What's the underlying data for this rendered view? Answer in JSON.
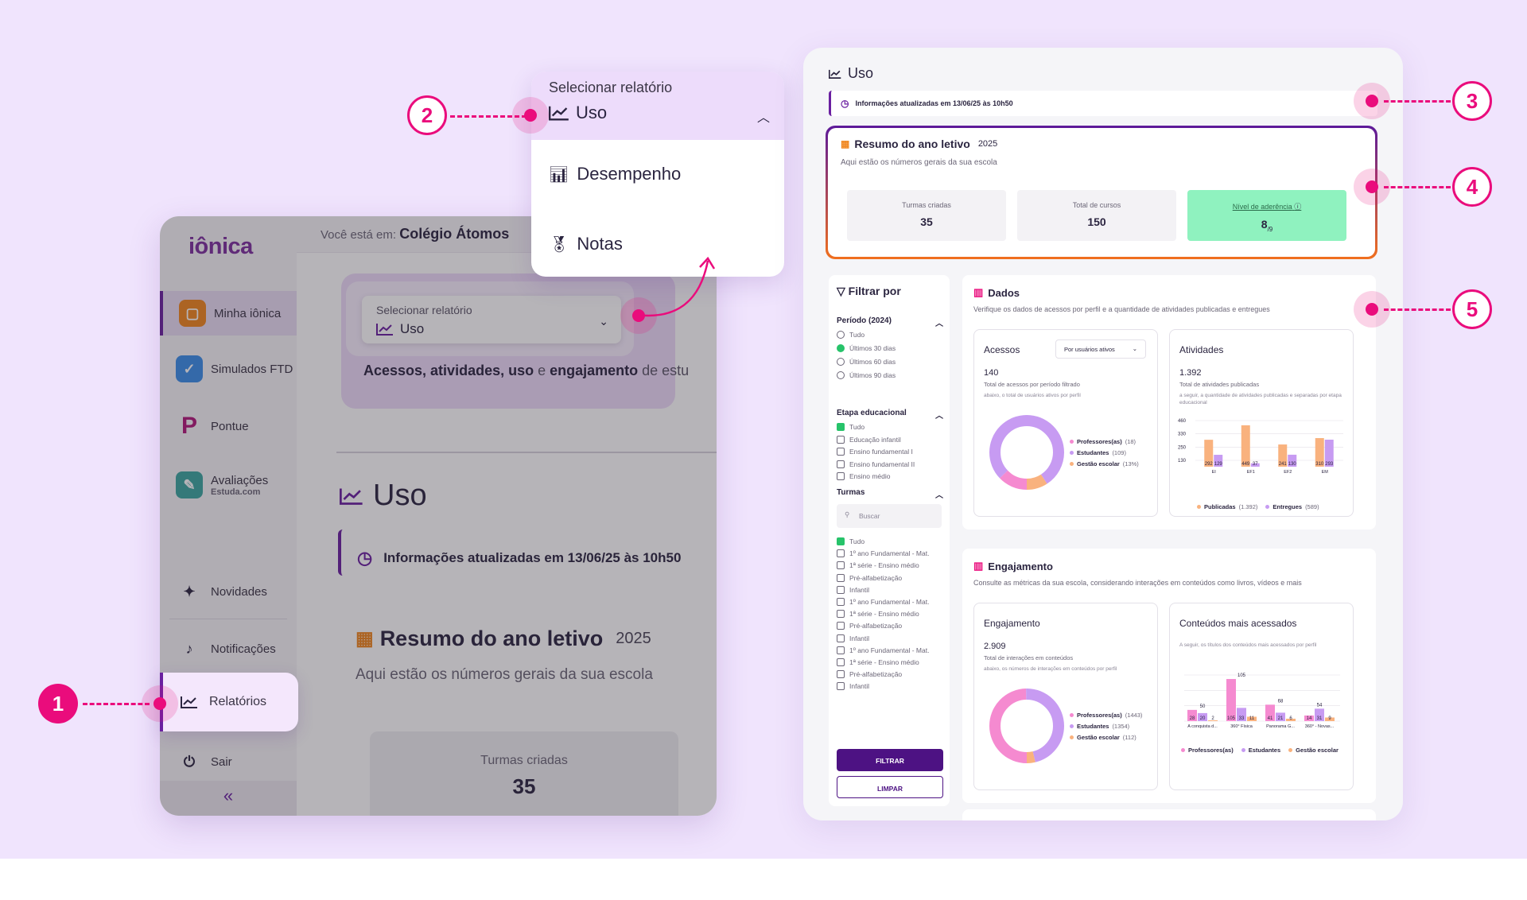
{
  "left_app": {
    "logo_text": "iônica",
    "breadcrumb_prefix": "Você está em:",
    "breadcrumb_school": "Colégio Átomos",
    "sidebar": {
      "items": [
        {
          "label": "Minha iônica",
          "icon": "backpack-icon"
        },
        {
          "label": "Simulados FTD",
          "icon": "checkmark-icon"
        },
        {
          "label": "Pontue",
          "icon": "pontue-logo-icon"
        },
        {
          "label": "Avaliações",
          "sublabel": "Estuda.com",
          "icon": "pencil-icon"
        },
        {
          "label": "Novidades",
          "icon": "sparkle-icon"
        },
        {
          "label": "Notificações",
          "icon": "bell-icon"
        },
        {
          "label": "Relatórios",
          "icon": "chart-line-icon"
        },
        {
          "label": "Sair",
          "icon": "power-icon"
        }
      ],
      "collapse_glyph": "«"
    },
    "report_selector": {
      "label": "Selecionar relatório",
      "value": "Uso"
    },
    "description_parts": [
      "Acessos, atividades, uso",
      " e ",
      "engajamento",
      " de estu"
    ],
    "page_title": "Uso",
    "info_text": "Informações atualizadas em 13/06/25 às 10h50",
    "summary": {
      "title": "Resumo do ano letivo",
      "year": "2025",
      "subtitle": "Aqui estão os números gerais da sua escola",
      "turmas_label": "Turmas criadas",
      "turmas_value": "35"
    }
  },
  "popup": {
    "label": "Selecionar relatório",
    "selected": "Uso",
    "options": [
      "Desempenho",
      "Notas"
    ]
  },
  "dashboard": {
    "title": "Uso",
    "info_text": "Informações atualizadas em 13/06/25 às 10h50",
    "summary": {
      "title": "Resumo do ano letivo",
      "year": "2025",
      "subtitle": "Aqui estão os números gerais da sua escola",
      "stats": [
        {
          "label": "Turmas criadas",
          "value": "35"
        },
        {
          "label": "Total de cursos",
          "value": "150"
        },
        {
          "label": "Nível de aderência",
          "value": "8",
          "suffix": "/9"
        }
      ]
    },
    "filter": {
      "title": "Filtrar por",
      "periodo_title": "Período (2024)",
      "periodo_options": [
        {
          "label": "Tudo",
          "checked": false
        },
        {
          "label": "Últimos 30 dias",
          "checked": true
        },
        {
          "label": "Últimos 60 dias",
          "checked": false
        },
        {
          "label": "Últimos 90 dias",
          "checked": false
        }
      ],
      "etapa_title": "Etapa educacional",
      "etapa_options": [
        {
          "label": "Tudo",
          "checked": true
        },
        {
          "label": "Educação infantil",
          "checked": false
        },
        {
          "label": "Ensino fundamental I",
          "checked": false
        },
        {
          "label": "Ensino fundamental II",
          "checked": false
        },
        {
          "label": "Ensino médio",
          "checked": false
        }
      ],
      "turmas_title": "Turmas",
      "search_placeholder": "Buscar",
      "turmas_options": [
        {
          "label": "Tudo",
          "checked": true
        },
        {
          "label": "1º ano Fundamental - Mat.",
          "checked": false
        },
        {
          "label": "1ª série - Ensino médio",
          "checked": false
        },
        {
          "label": "Pré-alfabetização",
          "checked": false
        },
        {
          "label": "Infantil",
          "checked": false
        },
        {
          "label": "1º ano Fundamental - Mat.",
          "checked": false
        },
        {
          "label": "1ª série - Ensino médio",
          "checked": false
        },
        {
          "label": "Pré-alfabetização",
          "checked": false
        },
        {
          "label": "Infantil",
          "checked": false
        },
        {
          "label": "1º ano Fundamental - Mat.",
          "checked": false
        },
        {
          "label": "1ª série - Ensino médio",
          "checked": false
        },
        {
          "label": "Pré-alfabetização",
          "checked": false
        },
        {
          "label": "Infantil",
          "checked": false
        }
      ],
      "filter_button": "FILTRAR",
      "clear_button": "LIMPAR"
    },
    "dados": {
      "title": "Dados",
      "subtitle": "Verifique os dados de acessos por perfil e a quantidade de atividades publicadas e entregues",
      "acessos": {
        "title": "Acessos",
        "dropdown": "Por usuários ativos",
        "value": "140",
        "sub": "Total de acessos por período filtrado",
        "sub2": "abaixo, o total de usuários ativos por perfil",
        "legend": [
          {
            "label": "Professores(as)",
            "pct": "(18)",
            "color": "#f58ad0"
          },
          {
            "label": "Estudantes",
            "pct": "(109)",
            "color": "#c79bf2"
          },
          {
            "label": "Gestão escolar",
            "pct": "(13%)",
            "color": "#f9b27e"
          }
        ]
      },
      "atividades": {
        "title": "Atividades",
        "value": "1.392",
        "sub": "Total de atividades publicadas",
        "sub2": "a seguir, a quantidade de atividades publicadas e separadas por etapa educacional",
        "legend": [
          {
            "label": "Publicadas",
            "pct": "(1.392)",
            "color": "#f9b27e"
          },
          {
            "label": "Entregues",
            "pct": "(589)",
            "color": "#c79bf2"
          }
        ]
      }
    },
    "engajamento": {
      "title": "Engajamento",
      "subtitle": "Consulte as métricas da sua escola, considerando interações em conteúdos como livros, vídeos e mais",
      "engajamento_card": {
        "title": "Engajamento",
        "value": "2.909",
        "sub": "Total de interações em conteúdos",
        "sub2": "abaixo, os números de interações em conteúdos por perfil",
        "legend": [
          {
            "label": "Professores(as)",
            "pct": "(1443)",
            "color": "#f58ad0"
          },
          {
            "label": "Estudantes",
            "pct": "(1354)",
            "color": "#c79bf2"
          },
          {
            "label": "Gestão escolar",
            "pct": "(112)",
            "color": "#f9b27e"
          }
        ]
      },
      "conteudos": {
        "title": "Conteúdos mais acessados",
        "sub": "A seguir, os títulos dos conteúdos mais acessados por perfil",
        "legend": [
          {
            "label": "Professores(as)",
            "color": "#f58ad0"
          },
          {
            "label": "Estudantes",
            "color": "#c79bf2"
          },
          {
            "label": "Gestão escolar",
            "color": "#f9b27e"
          }
        ]
      }
    }
  },
  "annotations": [
    "1",
    "2",
    "3",
    "4",
    "5"
  ],
  "chart_data": [
    {
      "type": "pie",
      "title": "Acessos",
      "categories": [
        "Professores(as)",
        "Estudantes",
        "Gestão escolar"
      ],
      "values": [
        18,
        109,
        13
      ],
      "colors": [
        "#f58ad0",
        "#c79bf2",
        "#f9b27e"
      ]
    },
    {
      "type": "bar",
      "title": "Atividades",
      "categories": [
        "EI",
        "EF1",
        "EF2",
        "EM"
      ],
      "series": [
        {
          "name": "Publicadas",
          "values": [
            292,
            449,
            241,
            310
          ],
          "color": "#f9b27e"
        },
        {
          "name": "Entregues",
          "values": [
            129,
            37,
            130,
            293
          ],
          "color": "#c79bf2"
        }
      ],
      "yticks": [
        "460",
        "330",
        "250",
        "130"
      ],
      "ylim": [
        0,
        500
      ]
    },
    {
      "type": "pie",
      "title": "Engajamento",
      "categories": [
        "Professores(as)",
        "Estudantes",
        "Gestão escolar"
      ],
      "values": [
        1443,
        1354,
        112
      ],
      "colors": [
        "#f58ad0",
        "#c79bf2",
        "#f9b27e"
      ]
    },
    {
      "type": "bar",
      "title": "Conteúdos mais acessados",
      "categories": [
        "A conquista d...",
        "360° Física",
        "Panorama G...",
        "360° - Novas..."
      ],
      "series": [
        {
          "name": "Professores(as)",
          "values": [
            28,
            105,
            41,
            14
          ],
          "color": "#f58ad0"
        },
        {
          "name": "Estudantes",
          "values": [
            20,
            33,
            21,
            31
          ],
          "color": "#c79bf2"
        },
        {
          "name": "Gestão escolar",
          "values": [
            2,
            11,
            6,
            9
          ],
          "color": "#f9b27e"
        }
      ],
      "top_labels": [
        "50",
        "105",
        "68",
        "54"
      ],
      "ylim": [
        0,
        115
      ]
    }
  ]
}
